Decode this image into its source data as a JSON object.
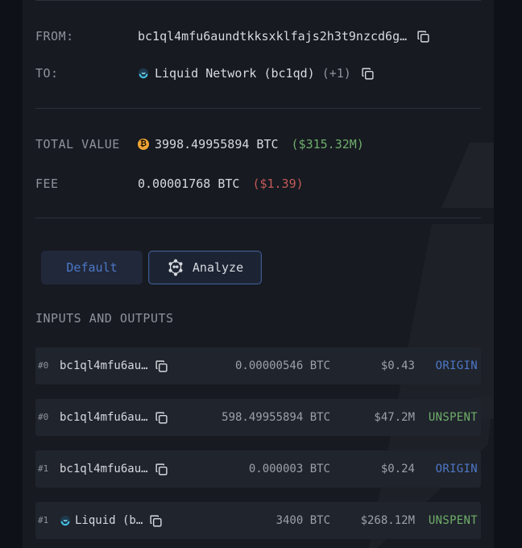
{
  "tx": {
    "from_label": "FROM:",
    "from_value": "bc1ql4mfu6aundtkksxklfajs2h3t9nzcd6g…",
    "to_label": "TO:",
    "to_value": "Liquid Network (bc1qd)",
    "to_extra": "(+1)",
    "total_label": "TOTAL VALUE",
    "total_btc": "3998.49955894 BTC",
    "total_usd": "($315.32M)",
    "fee_label": "FEE",
    "fee_btc": "0.00001768 BTC",
    "fee_usd": "($1.39)"
  },
  "tabs": {
    "default_label": "Default",
    "analyze_label": "Analyze"
  },
  "io": {
    "title": "INPUTS AND OUTPUTS",
    "rows": [
      {
        "idx": "#0",
        "addr": "bc1ql4mfu6au…",
        "amount": "0.00000546 BTC",
        "usd": "$0.43",
        "status": "ORIGIN"
      },
      {
        "idx": "#0",
        "addr": "bc1ql4mfu6au…",
        "amount": "598.49955894 BTC",
        "usd": "$47.2M",
        "status": "UNSPENT"
      },
      {
        "idx": "#1",
        "addr": "bc1ql4mfu6au…",
        "amount": "0.000003 BTC",
        "usd": "$0.24",
        "status": "ORIGIN"
      },
      {
        "idx": "#1",
        "addr": "Liquid (b…",
        "amount": "3400 BTC",
        "usd": "$268.12M",
        "status": "UNSPENT"
      }
    ]
  },
  "colors": {
    "accent_blue": "#4d78c8",
    "green": "#6fae6b",
    "red": "#c25b58",
    "bitcoin": "#f0a534"
  },
  "icons": [
    "copy-icon",
    "liquid-network-icon",
    "bitcoin-icon",
    "analyze-icon"
  ]
}
